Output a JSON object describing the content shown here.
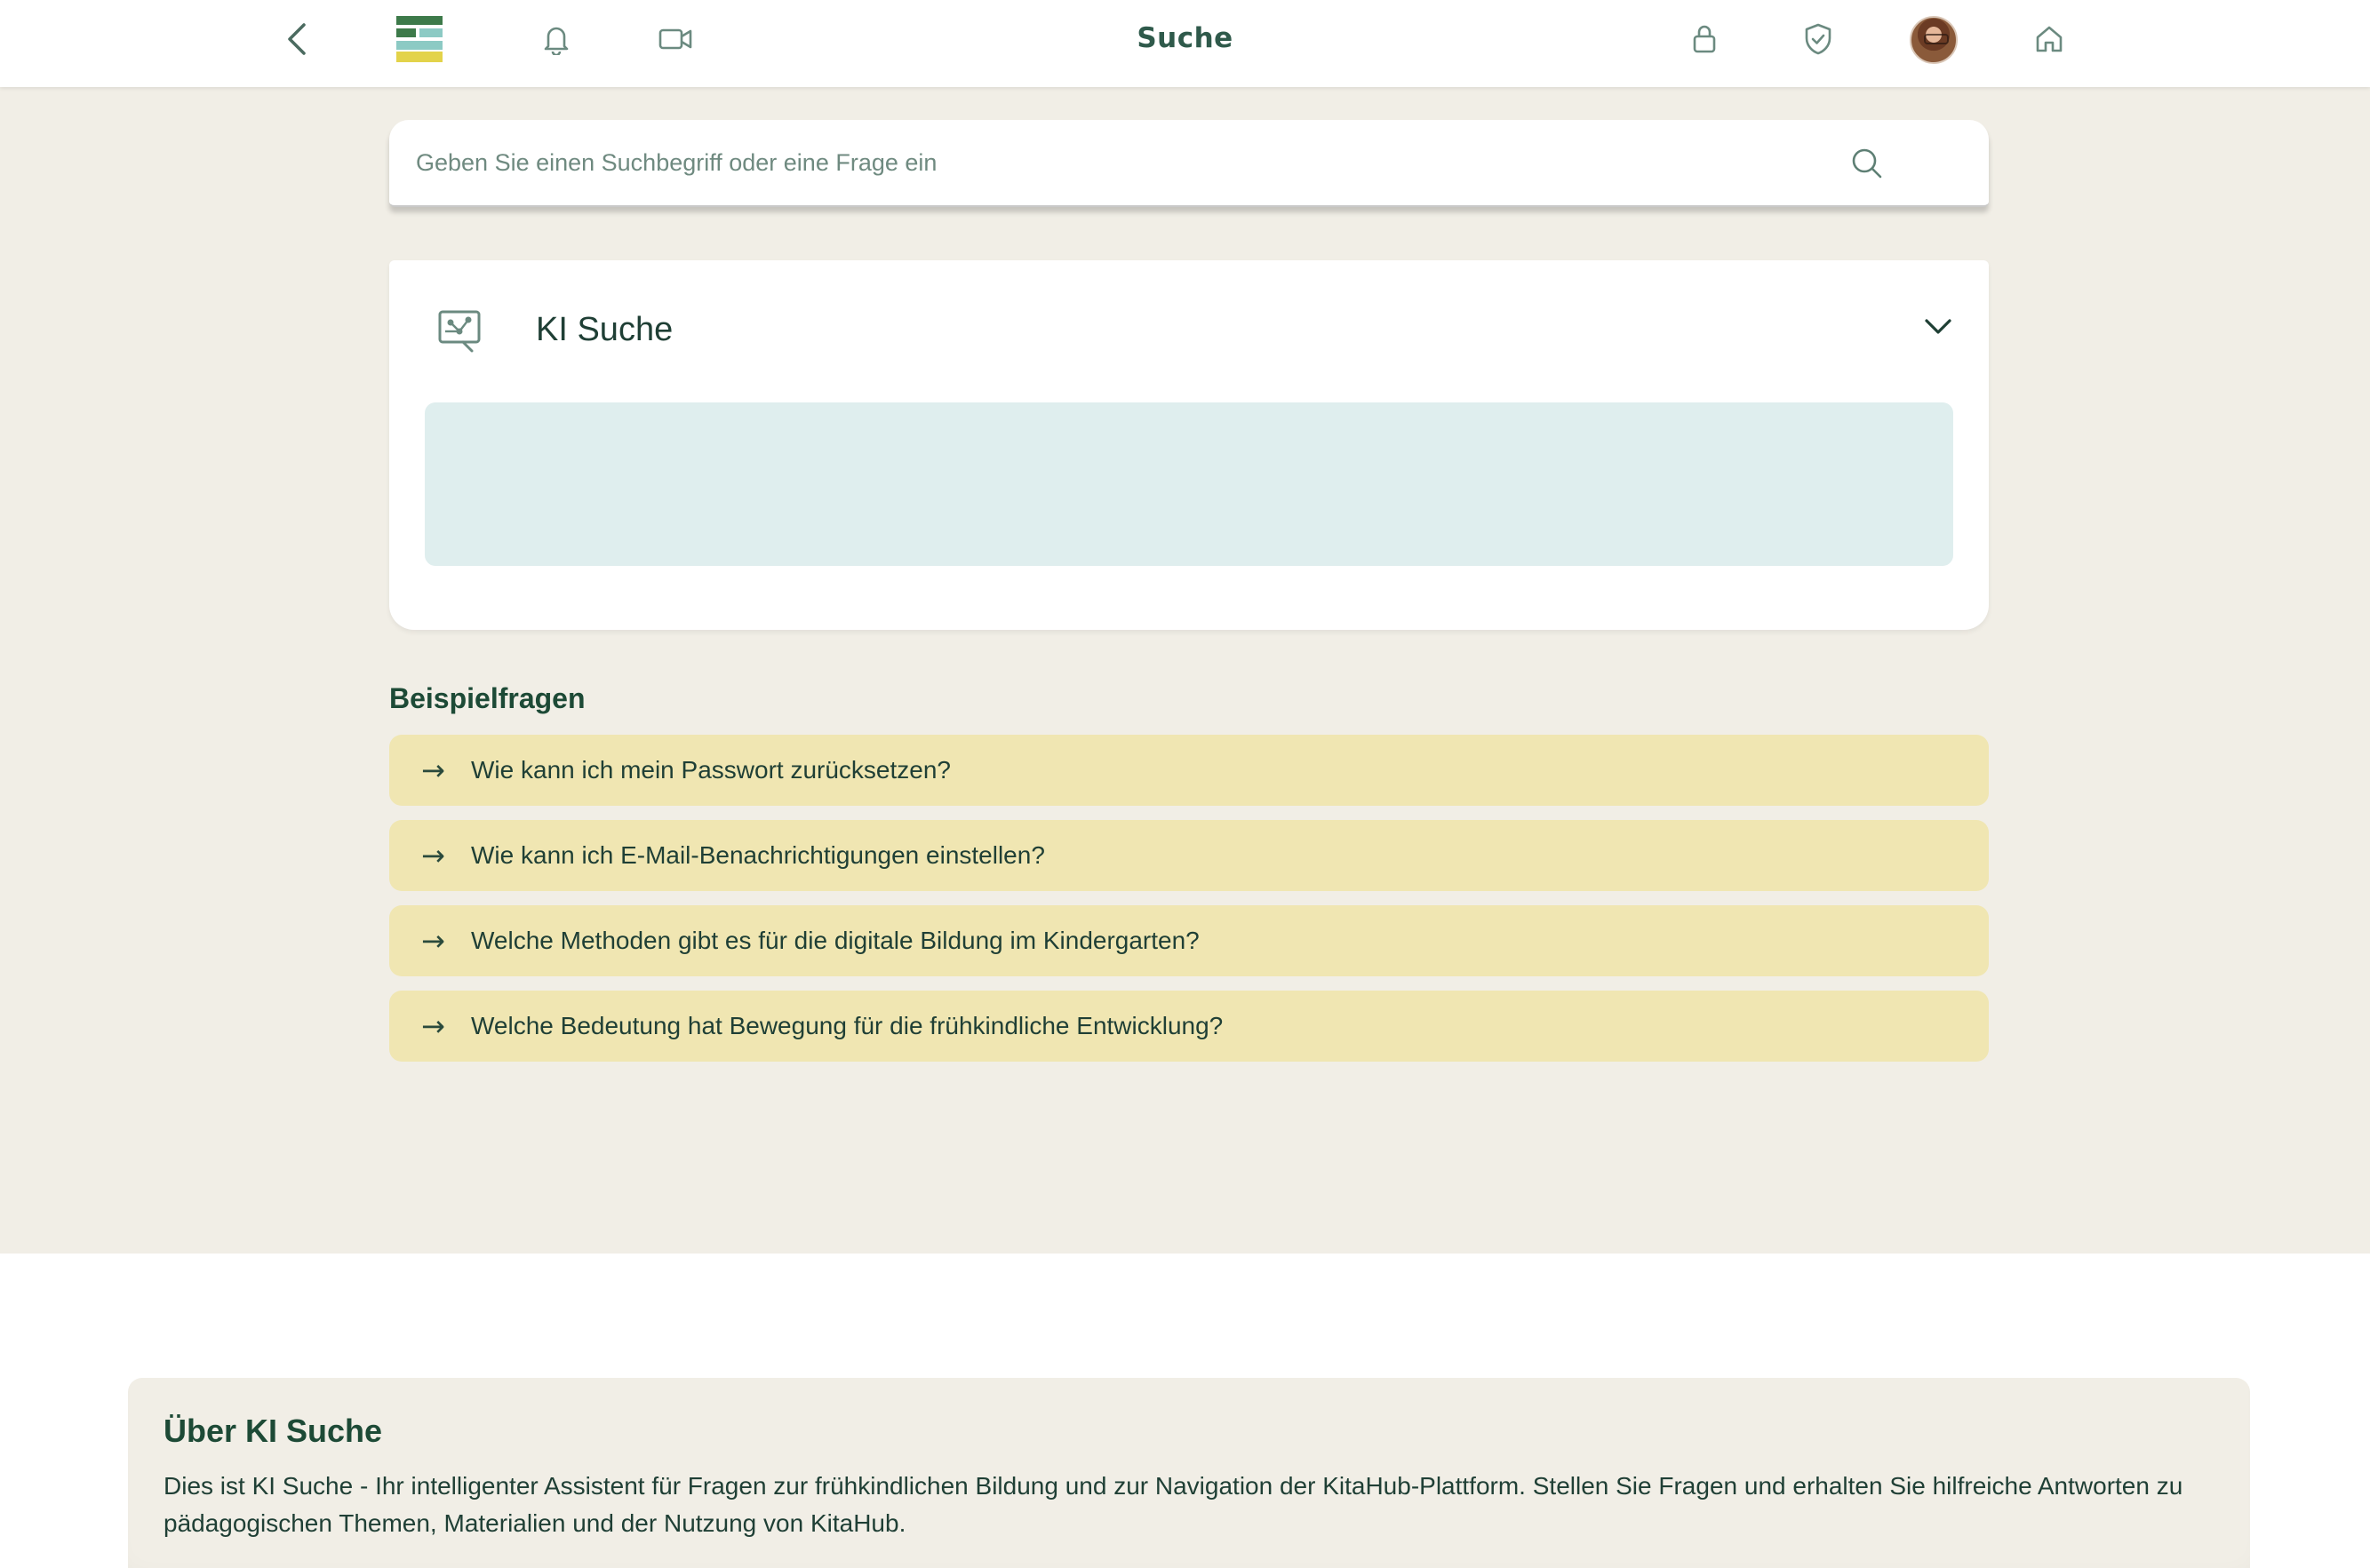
{
  "topbar": {
    "title": "Suche",
    "icons": [
      "back-icon",
      "logo-icon",
      "bell-icon",
      "video-icon",
      "lock-icon",
      "shield-icon",
      "avatar",
      "home-icon"
    ]
  },
  "search": {
    "placeholder": "Geben Sie einen Suchbegriff oder eine Frage ein",
    "value": ""
  },
  "ki_card": {
    "title": "KI Suche",
    "answer": ""
  },
  "examples": {
    "heading": "Beispielfragen",
    "arrow": "→",
    "items": [
      "Wie kann ich mein Passwort zurücksetzen?",
      "Wie kann ich E-Mail-Benachrichtigungen einstellen?",
      "Welche Methoden gibt es für die digitale Bildung im Kindergarten?",
      "Welche Bedeutung hat Bewegung für die frühkindliche Entwicklung?"
    ]
  },
  "about": {
    "title": "Über KI Suche",
    "text": "Dies ist KI Suche - Ihr intelligenter Assistent für Fragen zur frühkindlichen Bildung und zur Navigation der KitaHub-Plattform. Stellen Sie Fragen und erhalten Sie hilfreiche Antworten zu pädagogischen Themen, Materialien und der Nutzung von KitaHub."
  },
  "colors": {
    "page_bg": "#f1eee6",
    "primary_text": "#1f4a3a",
    "example_bg": "#f0e6b2",
    "answer_bg": "#dfeeee",
    "logo_green": "#3d7a4a",
    "logo_teal": "#8ccac4",
    "logo_yellow": "#e3d34a"
  }
}
